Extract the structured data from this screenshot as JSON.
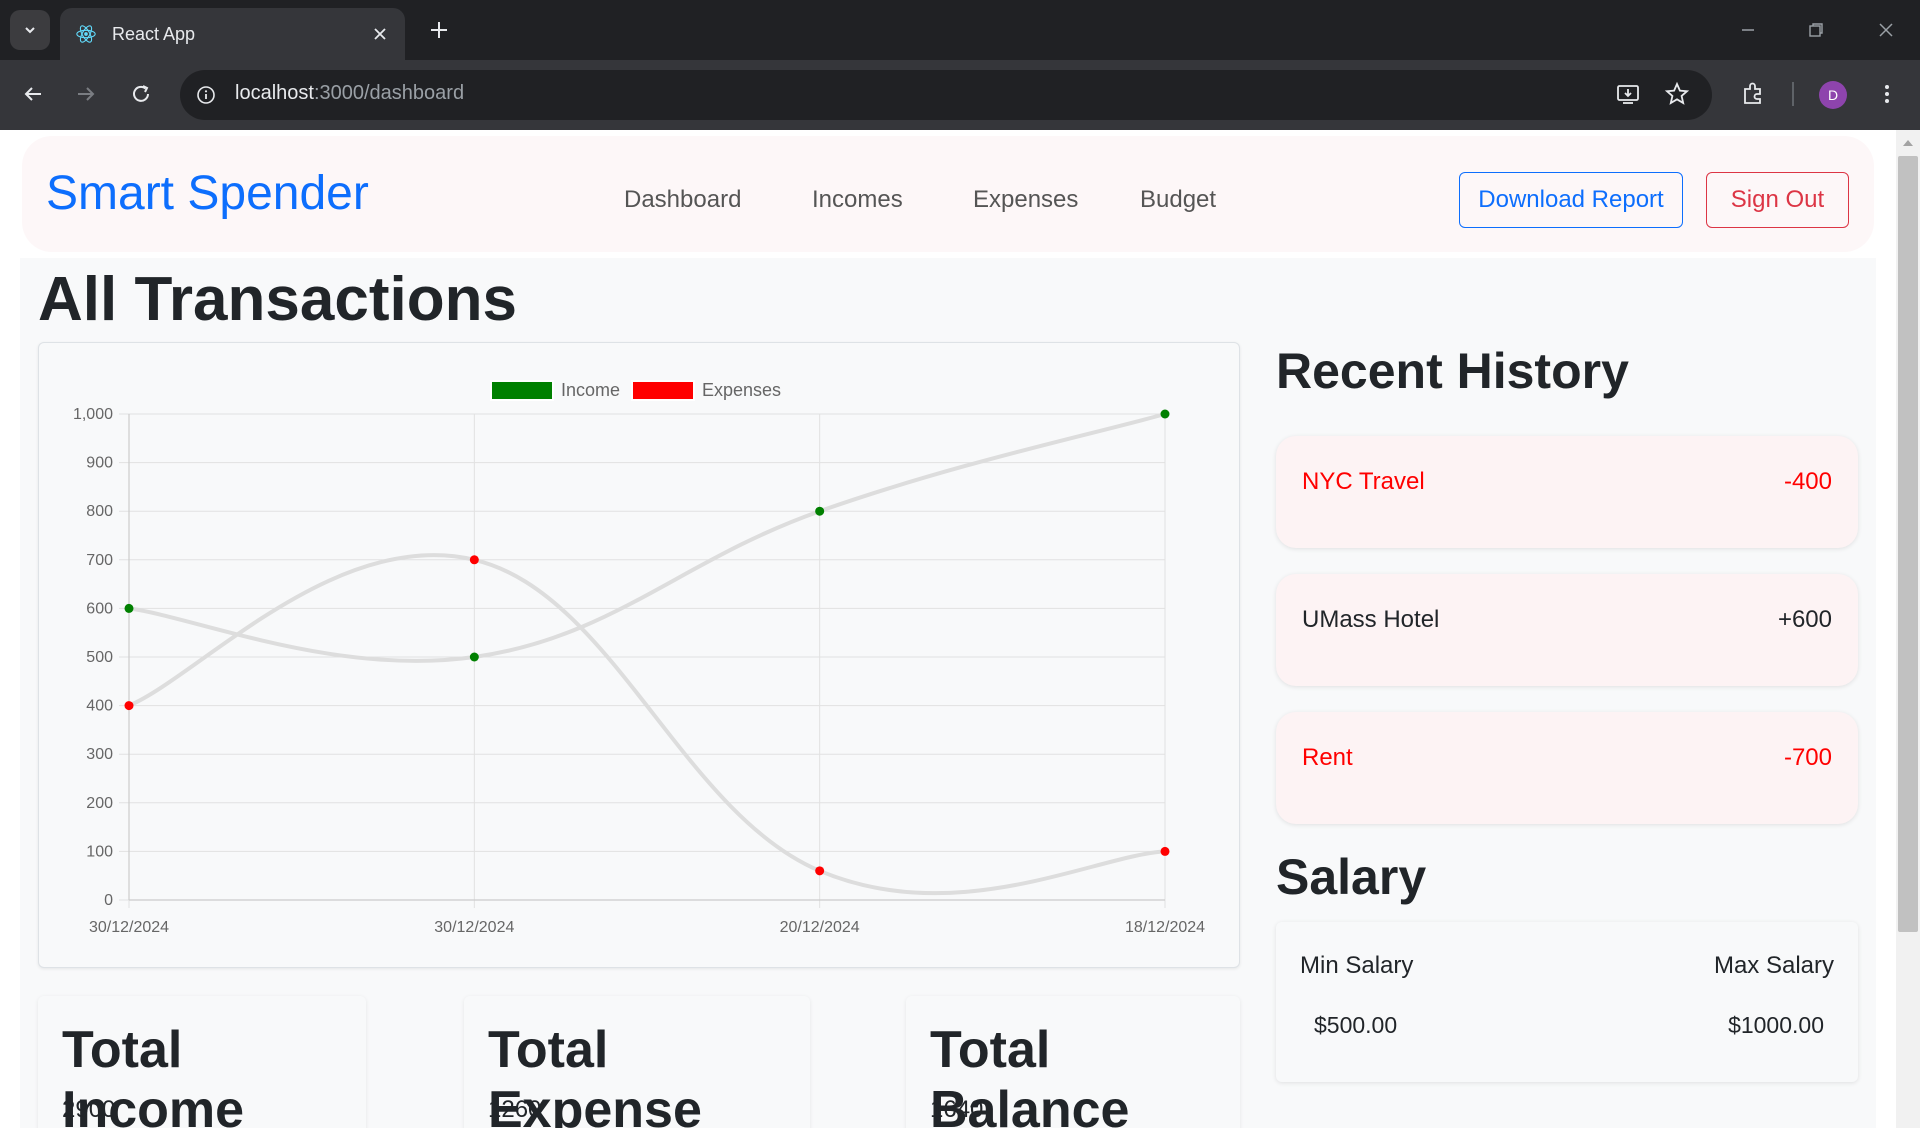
{
  "browser": {
    "tab_title": "React App",
    "url_host": "localhost",
    "url_path": ":3000/dashboard",
    "profile_initial": "D",
    "icons": [
      "tab-search-icon",
      "react-logo-icon",
      "close-icon",
      "plus-icon",
      "minimize-icon",
      "restore-icon",
      "window-close-icon",
      "back-arrow-icon",
      "forward-arrow-icon",
      "reload-icon",
      "site-info-icon",
      "install-app-icon",
      "star-icon",
      "extensions-icon",
      "kebab-menu-icon"
    ]
  },
  "navbar": {
    "brand": "Smart Spender",
    "links": [
      "Dashboard",
      "Incomes",
      "Expenses",
      "Budget"
    ],
    "download_label": "Download Report",
    "signout_label": "Sign Out"
  },
  "page": {
    "title": "All Transactions"
  },
  "chart_data": {
    "type": "line",
    "x": [
      "30/12/2024",
      "30/12/2024",
      "20/12/2024",
      "18/12/2024"
    ],
    "series": [
      {
        "name": "Income",
        "values": [
          600,
          500,
          800,
          1000
        ],
        "color": "#008000"
      },
      {
        "name": "Expenses",
        "values": [
          400,
          700,
          60,
          100
        ],
        "color": "#ff0000"
      }
    ],
    "line_color": "#dddddd",
    "yticks": [
      "0",
      "100",
      "200",
      "300",
      "400",
      "500",
      "600",
      "700",
      "800",
      "900",
      "1,000"
    ],
    "ylim": [
      0,
      1000
    ],
    "grid": true,
    "legend_position": "top-center"
  },
  "totals": [
    {
      "title": "Total Income",
      "value": "2900"
    },
    {
      "title": "Total Expense",
      "value": "1260"
    },
    {
      "title": "Total Balance",
      "value": "1640"
    }
  ],
  "history": {
    "title": "Recent History",
    "items": [
      {
        "name": "NYC Travel",
        "amount": "-400",
        "color": "#ff0000"
      },
      {
        "name": "UMass Hotel",
        "amount": "+600",
        "color": "#212529"
      },
      {
        "name": "Rent",
        "amount": "-700",
        "color": "#ff0000"
      }
    ]
  },
  "salary": {
    "title": "Salary",
    "min_label": "Min Salary",
    "max_label": "Max Salary",
    "min_value": "$500.00",
    "max_value": "$1000.00"
  },
  "colors": {
    "brand": "#0d6efd",
    "danger": "#dc3545"
  }
}
